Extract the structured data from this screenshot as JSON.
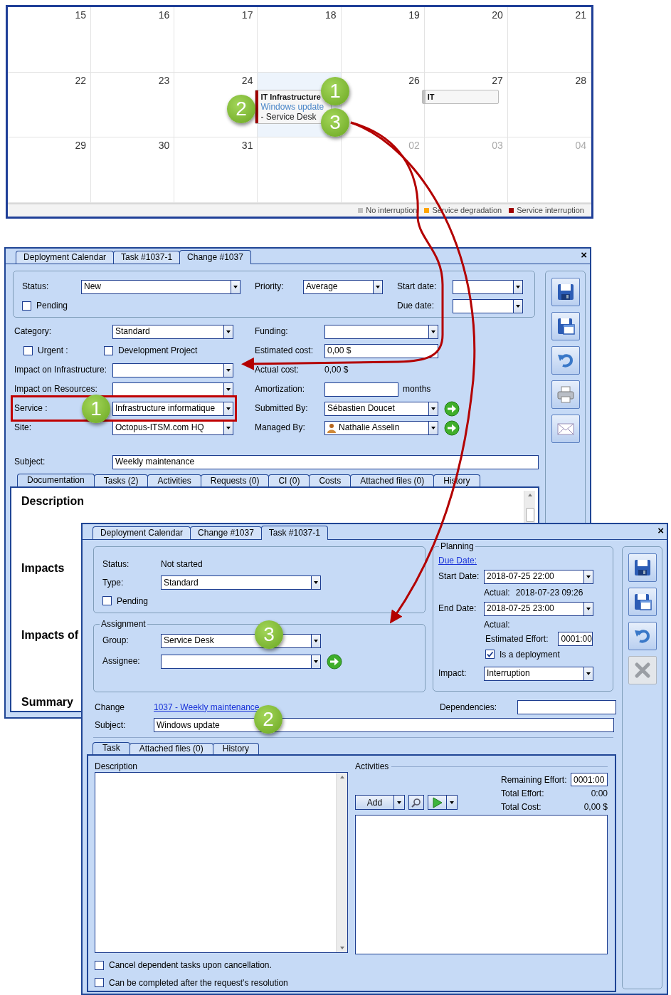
{
  "calendar": {
    "weeks": [
      {
        "days": [
          {
            "number": "15",
            "other_month": false,
            "highlighted": false
          },
          {
            "number": "16",
            "other_month": false,
            "highlighted": false
          },
          {
            "number": "17",
            "other_month": false,
            "highlighted": false
          },
          {
            "number": "18",
            "other_month": false,
            "highlighted": false
          },
          {
            "number": "19",
            "other_month": false,
            "highlighted": false
          },
          {
            "number": "20",
            "other_month": false,
            "highlighted": false
          },
          {
            "number": "21",
            "other_month": false,
            "highlighted": false
          }
        ]
      },
      {
        "days": [
          {
            "number": "22",
            "other_month": false,
            "highlighted": false
          },
          {
            "number": "23",
            "other_month": false,
            "highlighted": false
          },
          {
            "number": "24",
            "other_month": false,
            "highlighted": false
          },
          {
            "highlighted": true,
            "events": [
              {
                "title": "IT Infrastructure",
                "link": "Windows update",
                "group": "- Service Desk",
                "color": "#a00000"
              }
            ]
          },
          {
            "number": "26",
            "other_month": false,
            "highlighted": false
          },
          {
            "number": "27",
            "other_month": false,
            "highlighted": false,
            "events": [
              {
                "title": "IT",
                "color": "#c0c0c0"
              }
            ]
          },
          {
            "number": "28",
            "other_month": false,
            "highlighted": false
          }
        ]
      },
      {
        "days": [
          {
            "number": "29",
            "other_month": false,
            "highlighted": false
          },
          {
            "number": "30",
            "other_month": false,
            "highlighted": false
          },
          {
            "number": "31",
            "other_month": false,
            "highlighted": false
          },
          {
            "highlighted": false
          },
          {
            "number": "02",
            "other_month": true,
            "highlighted": false
          },
          {
            "number": "03",
            "other_month": true,
            "highlighted": false
          },
          {
            "number": "04",
            "other_month": true,
            "highlighted": false
          }
        ]
      }
    ],
    "legend": [
      {
        "label": "No interruption",
        "color": "#c0c0c0"
      },
      {
        "label": "Service degradation",
        "color": "#ffa500"
      },
      {
        "label": "Service interruption",
        "color": "#a00000"
      }
    ],
    "callouts": [
      "1",
      "2",
      "3"
    ]
  },
  "change_window": {
    "tabs": [
      {
        "label": "Deployment Calendar",
        "selected": false
      },
      {
        "label": "Task #1037-1",
        "selected": false
      },
      {
        "label": "Change #1037",
        "selected": true
      }
    ],
    "close": "×",
    "header": [
      [
        {
          "kind": "combo",
          "label": "Status:",
          "value": "New"
        },
        {
          "kind": "checkbox",
          "label": "Pending",
          "checked": false
        }
      ],
      [
        {
          "kind": "combo",
          "label": "Priority:",
          "value": "Average"
        }
      ],
      [
        {
          "kind": "combo",
          "label": "Start date:"
        },
        {
          "kind": "combo",
          "label": "Due date:"
        }
      ]
    ],
    "fields": [
      [
        {
          "kind": "combo",
          "label": "Category:",
          "value": "Standard",
          "highlighted": false
        },
        {
          "kind": "checks",
          "items": [
            {
              "label": "Urgent :",
              "checked": false
            },
            {
              "label": "Development Project",
              "checked": false
            }
          ],
          "highlighted": false
        },
        {
          "kind": "combo",
          "label": "Impact on Infrastructure:",
          "highlighted": false
        },
        {
          "kind": "combo",
          "label": "Impact on Resources:",
          "highlighted": false
        },
        {
          "kind": "combo",
          "label": "Service :",
          "value": "Infrastructure informatique",
          "highlighted": true
        },
        {
          "kind": "combo",
          "label": "Site:",
          "value": "Octopus-ITSM.com HQ",
          "highlighted": false
        }
      ],
      [
        {
          "kind": "combo",
          "label": "Funding:",
          "highlighted": false
        },
        {
          "kind": "text",
          "label": "Estimated cost:",
          "value": "0,00 $",
          "highlighted": false
        },
        {
          "kind": "static",
          "label": "Actual cost:",
          "value": "0,00 $",
          "highlighted": false
        },
        {
          "kind": "text",
          "label": "Amortization:",
          "unit": "months",
          "highlighted": false
        },
        {
          "kind": "combo",
          "label": "Submitted By:",
          "value": "Sébastien Doucet",
          "go": true,
          "highlighted": false
        },
        {
          "kind": "combo",
          "label": "Managed By:",
          "value": "Nathalie Asselin",
          "avatar": true,
          "go": true,
          "highlighted": false
        }
      ]
    ],
    "subject": {
      "label": "Subject:",
      "value": "Weekly maintenance"
    },
    "content_tabs": [
      {
        "label": "Documentation",
        "selected": true
      },
      {
        "label": "Tasks (2)",
        "selected": false
      },
      {
        "label": "Activities",
        "selected": false
      },
      {
        "label": "Requests (0)",
        "selected": false
      },
      {
        "label": "CI (0)",
        "selected": false
      },
      {
        "label": "Costs",
        "selected": false
      },
      {
        "label": "Attached files (0)",
        "selected": false
      },
      {
        "label": "History",
        "selected": false
      }
    ],
    "sections": [
      "Description",
      "Impacts",
      "Impacts of",
      "Summary"
    ],
    "toolbar": [
      {
        "kind": "save",
        "disabled": false
      },
      {
        "kind": "save_new",
        "disabled": false
      },
      {
        "kind": "undo",
        "disabled": false
      },
      {
        "kind": "print",
        "disabled": false
      },
      {
        "kind": "email",
        "disabled": false
      }
    ],
    "callouts": [
      "1"
    ]
  },
  "task_window": {
    "tabs": [
      {
        "label": "Deployment Calendar",
        "selected": false
      },
      {
        "label": "Change #1037",
        "selected": false
      },
      {
        "label": "Task #1037-1",
        "selected": true
      }
    ],
    "close": "×",
    "general": [
      {
        "kind": "static",
        "label": "Status:",
        "value": "Not started"
      },
      {
        "kind": "combo",
        "label": "Type:",
        "value": "Standard"
      },
      {
        "kind": "checkbox",
        "label": "Pending",
        "checked": false
      }
    ],
    "assignment": {
      "title": "Assignment",
      "fields": [
        {
          "kind": "combo",
          "label": "Group:",
          "value": "Service Desk"
        },
        {
          "kind": "combo",
          "label": "Assignee:",
          "go": true
        }
      ]
    },
    "planning": {
      "title": "Planning",
      "fields": [
        {
          "kind": "link",
          "label": "Due Date:"
        },
        {
          "kind": "combo",
          "label": "Start Date:",
          "value": "2018-07-25 22:00"
        },
        {
          "kind": "sub",
          "label": "Actual:",
          "value": "2018-07-23 09:26"
        },
        {
          "kind": "combo",
          "label": "End Date:",
          "value": "2018-07-25 23:00"
        },
        {
          "kind": "sub",
          "label": "Actual:"
        },
        {
          "kind": "sub_text",
          "label": "Estimated Effort:",
          "value": "0001:00"
        },
        {
          "kind": "sub_checkbox",
          "label": "Is a deployment",
          "checked": true
        },
        {
          "kind": "combo",
          "label": "Impact:",
          "value": "Interruption"
        }
      ]
    },
    "change": {
      "label": "Change",
      "link": "1037 - Weekly maintenance"
    },
    "dependencies": {
      "label": "Dependencies:"
    },
    "subject": {
      "label": "Subject:",
      "value": "Windows update"
    },
    "content_tabs": [
      {
        "label": "Task",
        "selected": true
      },
      {
        "label": "Attached files (0)",
        "selected": false
      },
      {
        "label": "History",
        "selected": false
      }
    ],
    "description": {
      "label": "Description"
    },
    "activities": {
      "title": "Activities",
      "add": "Add",
      "stats": [
        {
          "kind": "field",
          "label": "Remaining Effort:",
          "value": "0001:00"
        },
        {
          "kind": "static",
          "label": "Total Effort:",
          "value": "0:00"
        },
        {
          "kind": "static",
          "label": "Total Cost:",
          "value": "0,00 $"
        }
      ]
    },
    "options": [
      {
        "label": "Cancel dependent tasks upon cancellation.",
        "checked": false
      },
      {
        "label": "Can be completed after the request's resolution",
        "checked": false
      }
    ],
    "toolbar": [
      {
        "kind": "save",
        "disabled": false
      },
      {
        "kind": "save_new",
        "disabled": false
      },
      {
        "kind": "undo",
        "disabled": false
      },
      {
        "kind": "delete",
        "disabled": true
      }
    ],
    "callouts": [
      "3",
      "2"
    ]
  }
}
